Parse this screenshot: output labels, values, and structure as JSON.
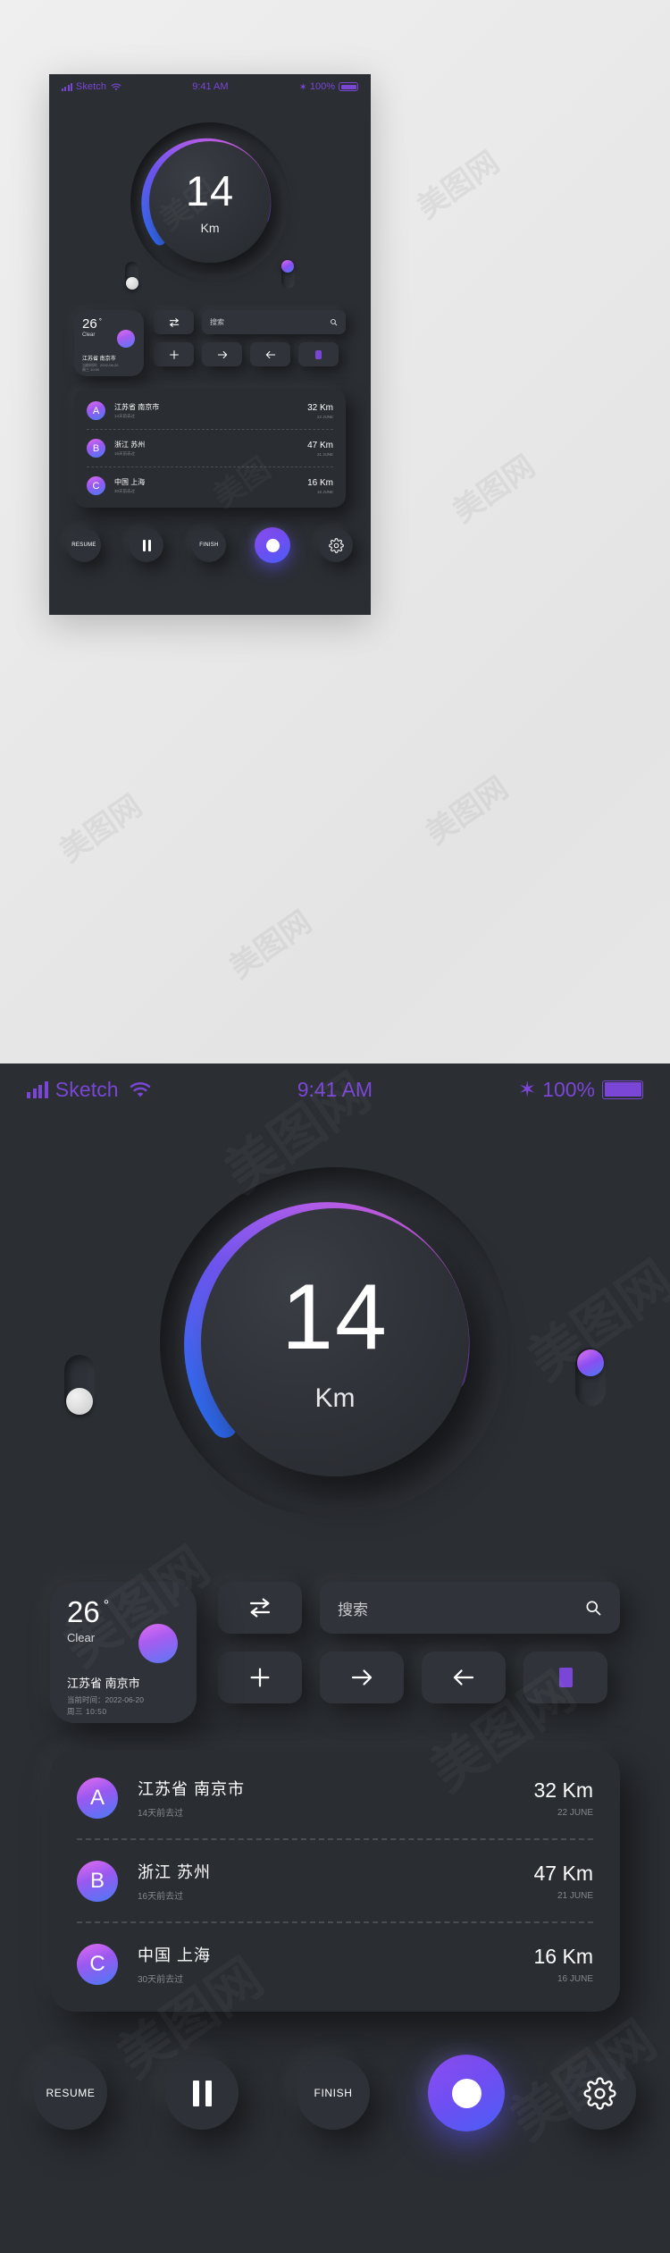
{
  "status_bar": {
    "carrier": "Sketch",
    "wifi_icon": "wifi-icon",
    "signal_icon": "signal-bars-icon",
    "time": "9:41 AM",
    "bluetooth_icon": "bluetooth-icon",
    "bluetooth_glyph": "✶",
    "battery_percent": "100%",
    "battery_icon": "battery-icon"
  },
  "dial": {
    "value": "14",
    "unit": "Km",
    "left_handle": "slider-handle-grey",
    "right_handle": "slider-handle-purple",
    "arc_start_color": "#2f6bf5",
    "arc_mid_color": "#8a4ef0",
    "arc_end_color": "#d95ff0"
  },
  "weather": {
    "temperature": "26",
    "degree": "°",
    "condition": "Clear",
    "city": "江苏省  南京市",
    "updated": "当前时间：2022-06-20",
    "weekday": "周三    10:50",
    "orb_icon": "weather-orb-icon"
  },
  "actions": {
    "swap_icon": "swap-arrows-icon",
    "plus_icon": "plus-icon",
    "arrow_right_icon": "arrow-right-icon",
    "arrow_left_icon": "arrow-left-icon",
    "bookmark_icon": "bookmark-icon",
    "search": {
      "placeholder": "搜索",
      "icon": "search-icon"
    }
  },
  "routes": [
    {
      "badge": "A",
      "title": "江苏省  南京市",
      "subtitle": "14天前去过",
      "distance": "32 Km",
      "date": "22 JUNE"
    },
    {
      "badge": "B",
      "title": "浙江  苏州",
      "subtitle": "16天前去过",
      "distance": "47 Km",
      "date": "21 JUNE"
    },
    {
      "badge": "C",
      "title": "中国  上海",
      "subtitle": "30天前去过",
      "distance": "16 Km",
      "date": "16 JUNE"
    }
  ],
  "toolbar": {
    "resume_label": "RESUME",
    "pause_icon": "pause-icon",
    "finish_label": "FINISH",
    "record_icon": "record-icon",
    "settings_icon": "gear-icon"
  },
  "colors": {
    "accent_purple": "#7a46d6",
    "background": "#2b2e33",
    "card": "#2f3238",
    "text_primary": "#ffffff",
    "text_muted": "#85878e"
  }
}
